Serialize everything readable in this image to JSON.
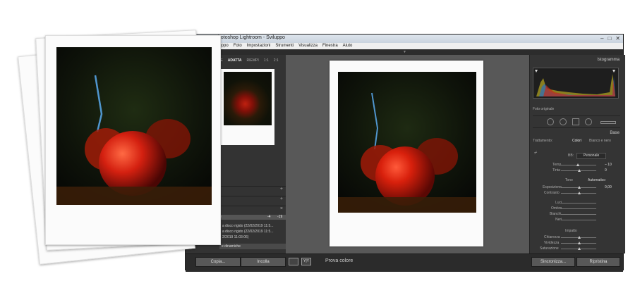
{
  "window": {
    "title": "hotoshop Lightroom - Sviluppo",
    "controls": [
      "–",
      "□",
      "✕"
    ]
  },
  "menubar": [
    "luppo",
    "Foto",
    "Impostazioni",
    "Strumenti",
    "Visualizza",
    "Finestra",
    "Aiuto"
  ],
  "left_panel": {
    "tabs": [
      "IE",
      "ADATTA",
      "RIEMPI",
      "1:1",
      "2:1"
    ],
    "history_row": {
      "label": "e",
      "v1": "-4",
      "v2": "-19"
    },
    "history_items": [
      "a disco rigido (22/02/2019 11:5...",
      "a disco rigido (22/02/2019 11:5...",
      "2/2019 11:03:06)"
    ],
    "preset_row": "e dinamiche"
  },
  "right_panel": {
    "histogram_title": "Istogramma",
    "original_photo_label": "Foto originale",
    "base_title": "Base",
    "treatment_label": "Trattamento:",
    "tabs": {
      "color": "Colori",
      "bw": "Bianco e nero"
    },
    "wb_label": "BB:",
    "wb_value": "Personale",
    "temp_label": "Temp",
    "temp_value": "– 10",
    "tint_label": "Tinta",
    "tone_label": "Tono",
    "tone_auto": "Automatico",
    "exposure_label": "Esposizione",
    "exposure_value": "0,00",
    "contrast_label": "Contrasto",
    "highlights_label": "Luci",
    "shadows_label": "Ombre",
    "whites_label": "Bianchi",
    "blacks_label": "Neri",
    "presence_label": "Impatto",
    "clarity_label": "Chiarezza",
    "vibrance_label": "Vividezza",
    "saturation_label": "Saturazione",
    "zero": "0"
  },
  "bottom": {
    "copy_button": "Copia...",
    "paste_button": "Incolla",
    "yy_label": "Y|Y",
    "soft_proof": "Prova colore",
    "sync_button": "Sincronizza...",
    "reset_button": "Ripristina"
  },
  "colors": {
    "accent": "#7a7a7a",
    "panel": "#343434",
    "canvas": "#585858"
  }
}
